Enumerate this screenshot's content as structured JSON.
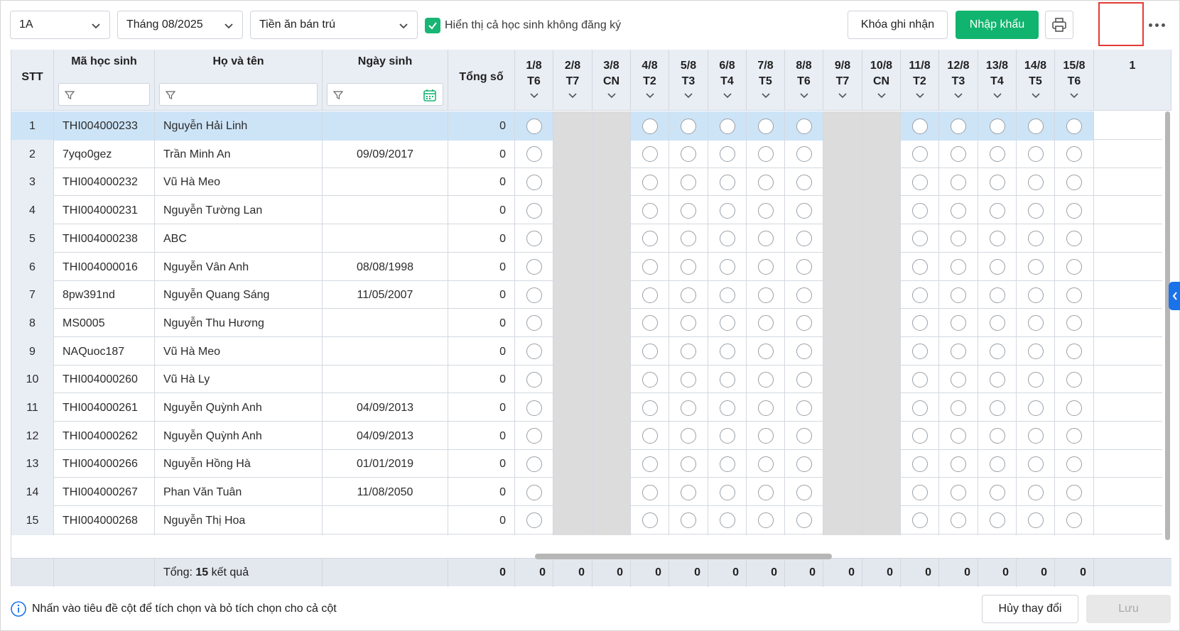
{
  "toolbar": {
    "class_select": "1A",
    "month_select": "Tháng 08/2025",
    "fee_select": "Tiền ăn bán trú",
    "show_unregistered_label": "Hiển thị cả học sinh không đăng ký",
    "show_unregistered_checked": true,
    "lock_button": "Khóa ghi nhận",
    "import_button": "Nhập khẩu",
    "print_icon": "printer-icon",
    "more_icon": "more-horizontal-icon"
  },
  "table": {
    "headers": {
      "stt": "STT",
      "student_code": "Mã học sinh",
      "full_name": "Họ và tên",
      "birth_date": "Ngày sinh",
      "total": "Tổng số"
    },
    "days": [
      {
        "date": "1/8",
        "weekday": "T6",
        "weekend": false
      },
      {
        "date": "2/8",
        "weekday": "T7",
        "weekend": true
      },
      {
        "date": "3/8",
        "weekday": "CN",
        "weekend": true
      },
      {
        "date": "4/8",
        "weekday": "T2",
        "weekend": false
      },
      {
        "date": "5/8",
        "weekday": "T3",
        "weekend": false
      },
      {
        "date": "6/8",
        "weekday": "T4",
        "weekend": false
      },
      {
        "date": "7/8",
        "weekday": "T5",
        "weekend": false
      },
      {
        "date": "8/8",
        "weekday": "T6",
        "weekend": false
      },
      {
        "date": "9/8",
        "weekday": "T7",
        "weekend": true
      },
      {
        "date": "10/8",
        "weekday": "CN",
        "weekend": true
      },
      {
        "date": "11/8",
        "weekday": "T2",
        "weekend": false
      },
      {
        "date": "12/8",
        "weekday": "T3",
        "weekend": false
      },
      {
        "date": "13/8",
        "weekday": "T4",
        "weekend": false
      },
      {
        "date": "14/8",
        "weekday": "T5",
        "weekend": false
      },
      {
        "date": "15/8",
        "weekday": "T6",
        "weekend": false
      },
      {
        "date": "1",
        "weekday": "",
        "weekend": false
      }
    ],
    "rows": [
      {
        "stt": "1",
        "code": "THI004000233",
        "name": "Nguyễn Hải Linh",
        "dob": "",
        "total": "0",
        "selected": true
      },
      {
        "stt": "2",
        "code": "7yqo0gez",
        "name": "Trần Minh An",
        "dob": "09/09/2017",
        "total": "0"
      },
      {
        "stt": "3",
        "code": "THI004000232",
        "name": "Vũ Hà Meo",
        "dob": "",
        "total": "0"
      },
      {
        "stt": "4",
        "code": "THI004000231",
        "name": "Nguyễn Tường Lan",
        "dob": "",
        "total": "0"
      },
      {
        "stt": "5",
        "code": "THI004000238",
        "name": "ABC",
        "dob": "",
        "total": "0"
      },
      {
        "stt": "6",
        "code": "THI004000016",
        "name": "Nguyễn Vân Anh",
        "dob": "08/08/1998",
        "total": "0"
      },
      {
        "stt": "7",
        "code": "8pw391nd",
        "name": "Nguyễn Quang Sáng",
        "dob": "11/05/2007",
        "total": "0"
      },
      {
        "stt": "8",
        "code": "MS0005",
        "name": "Nguyễn Thu Hương",
        "dob": "",
        "total": "0"
      },
      {
        "stt": "9",
        "code": "NAQuoc187",
        "name": "Vũ Hà Meo",
        "dob": "",
        "total": "0"
      },
      {
        "stt": "10",
        "code": "THI004000260",
        "name": "Vũ Hà Ly",
        "dob": "",
        "total": "0"
      },
      {
        "stt": "11",
        "code": "THI004000261",
        "name": "Nguyễn Quỳnh Anh",
        "dob": "04/09/2013",
        "total": "0"
      },
      {
        "stt": "12",
        "code": "THI004000262",
        "name": "Nguyễn Quỳnh Anh",
        "dob": "04/09/2013",
        "total": "0"
      },
      {
        "stt": "13",
        "code": "THI004000266",
        "name": "Nguyễn Hồng Hà",
        "dob": "01/01/2019",
        "total": "0"
      },
      {
        "stt": "14",
        "code": "THI004000267",
        "name": "Phan Văn Tuân",
        "dob": "11/08/2050",
        "total": "0"
      },
      {
        "stt": "15",
        "code": "THI004000268",
        "name": "Nguyễn Thị Hoa",
        "dob": "",
        "total": "0"
      }
    ],
    "footer": {
      "label_prefix": "Tổng: ",
      "count": "15",
      "label_suffix": " kết quả",
      "total": "0",
      "day_totals": [
        "0",
        "0",
        "0",
        "0",
        "0",
        "0",
        "0",
        "0",
        "0",
        "0",
        "0",
        "0",
        "0",
        "0",
        "0"
      ]
    }
  },
  "bottom": {
    "hint": "Nhấn vào tiêu đề cột để tích chọn và bỏ tích chọn cho cả cột",
    "cancel_button": "Hủy thay đổi",
    "save_button": "Lưu"
  },
  "colors": {
    "accent_green": "#11b46e",
    "selected_row": "#cde4f7",
    "weekend": "#dcdcdc",
    "header_bg": "#e9edf4",
    "highlight_red": "#e53935"
  }
}
